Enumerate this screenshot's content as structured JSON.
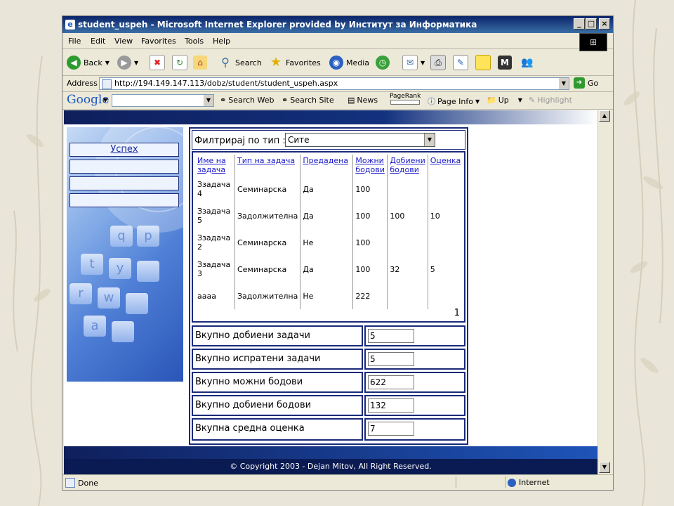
{
  "window": {
    "title": "student_uspeh - Microsoft Internet Explorer provided by Институт за Информатика"
  },
  "menu": [
    "File",
    "Edit",
    "View",
    "Favorites",
    "Tools",
    "Help"
  ],
  "toolbar": {
    "back": "Back",
    "search": "Search",
    "favorites": "Favorites",
    "media": "Media"
  },
  "address": {
    "label": "Address",
    "url": "http://194.149.147.113/dobz/student/student_uspeh.aspx",
    "go": "Go"
  },
  "googlebar": {
    "logo": "Google",
    "search_web": "Search Web",
    "search_site": "Search Site",
    "news": "News",
    "pagerank": "PageRank",
    "page_info": "Page Info",
    "up": "Up",
    "highlight": "Highlight"
  },
  "sidebar": {
    "items": [
      "Успех",
      "",
      "",
      ""
    ]
  },
  "filter": {
    "label": "Филтрирај по тип :",
    "selected": "Сите"
  },
  "grid": {
    "headers": [
      "Име на задача",
      "Тип на задача",
      "Предадена",
      "Можни бодови",
      "Добиени бодови",
      "Оценка"
    ],
    "rows": [
      [
        "Ззадача 4",
        "Семинарска",
        "Да",
        "100",
        "",
        ""
      ],
      [
        "Ззадача 5",
        "Задолжителна",
        "Да",
        "100",
        "100",
        "10"
      ],
      [
        "Ззадача 2",
        "Семинарска",
        "Не",
        "100",
        "",
        ""
      ],
      [
        "Ззадача 3",
        "Семинарска",
        "Да",
        "100",
        "32",
        "5"
      ],
      [
        "аааа",
        "Задолжителна",
        "Не",
        "222",
        "",
        ""
      ]
    ],
    "page": "1"
  },
  "summary": [
    {
      "label": "Вкупно добиени задачи",
      "value": "5"
    },
    {
      "label": "Вкупно испратени задачи",
      "value": "5"
    },
    {
      "label": "Вкупно можни бодови",
      "value": "622"
    },
    {
      "label": "Вкупно добиени бодови",
      "value": "132"
    },
    {
      "label": "Вкупна средна оценка",
      "value": "7"
    }
  ],
  "footer": {
    "copyright": "© Copyright 2003 - Dejan Mitov, All Right Reserved."
  },
  "status": {
    "text": "Done",
    "zone": "Internet"
  },
  "colors": {
    "brand_navy": "#1a2a7a",
    "link": "#1a1acc"
  }
}
